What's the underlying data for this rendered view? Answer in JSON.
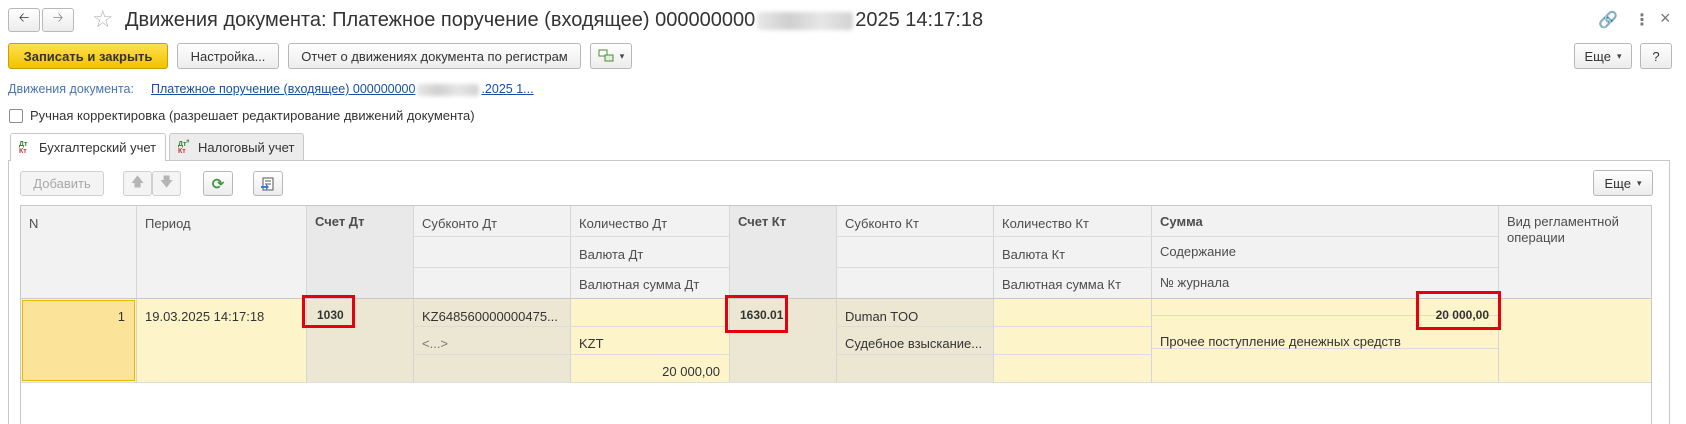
{
  "window": {
    "title_prefix": "Движения документа: Платежное поручение (входящее) 000000000",
    "title_suffix": "2025 14:17:18"
  },
  "toolbar": {
    "save_close": "Записать и закрыть",
    "settings": "Настройка...",
    "report": "Отчет о движениях документа по регистрам",
    "more": "Еще",
    "help": "?"
  },
  "doc_link": {
    "label": "Движения документа:",
    "value_prefix": "Платежное поручение (входящее) 000000000",
    "value_suffix": ".2025 1..."
  },
  "manual": {
    "label": "Ручная корректировка (разрешает редактирование движений документа)"
  },
  "tabs": [
    {
      "label": "Бухгалтерский учет",
      "icon": "dt-kt-icon"
    },
    {
      "label": "Налоговый учет",
      "icon": "dtn-kt-icon"
    }
  ],
  "grid_toolbar": {
    "add": "Добавить",
    "more": "Еще"
  },
  "table": {
    "headers": {
      "n": "N",
      "period": "Период",
      "schet_dt": "Счет Дт",
      "subkonto_dt": "Субконто Дт",
      "kol_dt": "Количество Дт",
      "val_dt": "Валюта Дт",
      "valsum_dt": "Валютная сумма Дт",
      "schet_kt": "Счет Кт",
      "subkonto_kt": "Субконто Кт",
      "kol_kt": "Количество Кт",
      "val_kt": "Валюта Кт",
      "valsum_kt": "Валютная сумма Кт",
      "summa": "Сумма",
      "soderzhanie": "Содержание",
      "journal": "№ журнала",
      "vid": "Вид регламентной операции"
    },
    "row": {
      "n": "1",
      "period": "19.03.2025 14:17:18",
      "schet_dt": "1030",
      "subkonto_dt_1": "KZ648560000000475...",
      "subkonto_dt_2": "<...>",
      "val_dt": "KZT",
      "valsum_dt": "20 000,00",
      "schet_kt": "1630.01",
      "subkonto_kt_1": "Duman TOO",
      "subkonto_kt_2": "Судебное взыскание...",
      "summa": "20 000,00",
      "soderzhanie": "Прочее поступление денежных средств"
    }
  },
  "colors": {
    "accent_yellow": "#f5c800",
    "row_highlight": "#fdf4c9",
    "row_dark": "#f1ecd9",
    "selected_cell": "#fbe39a",
    "highlight_box": "#e3000f",
    "link": "#1a4fa3"
  }
}
